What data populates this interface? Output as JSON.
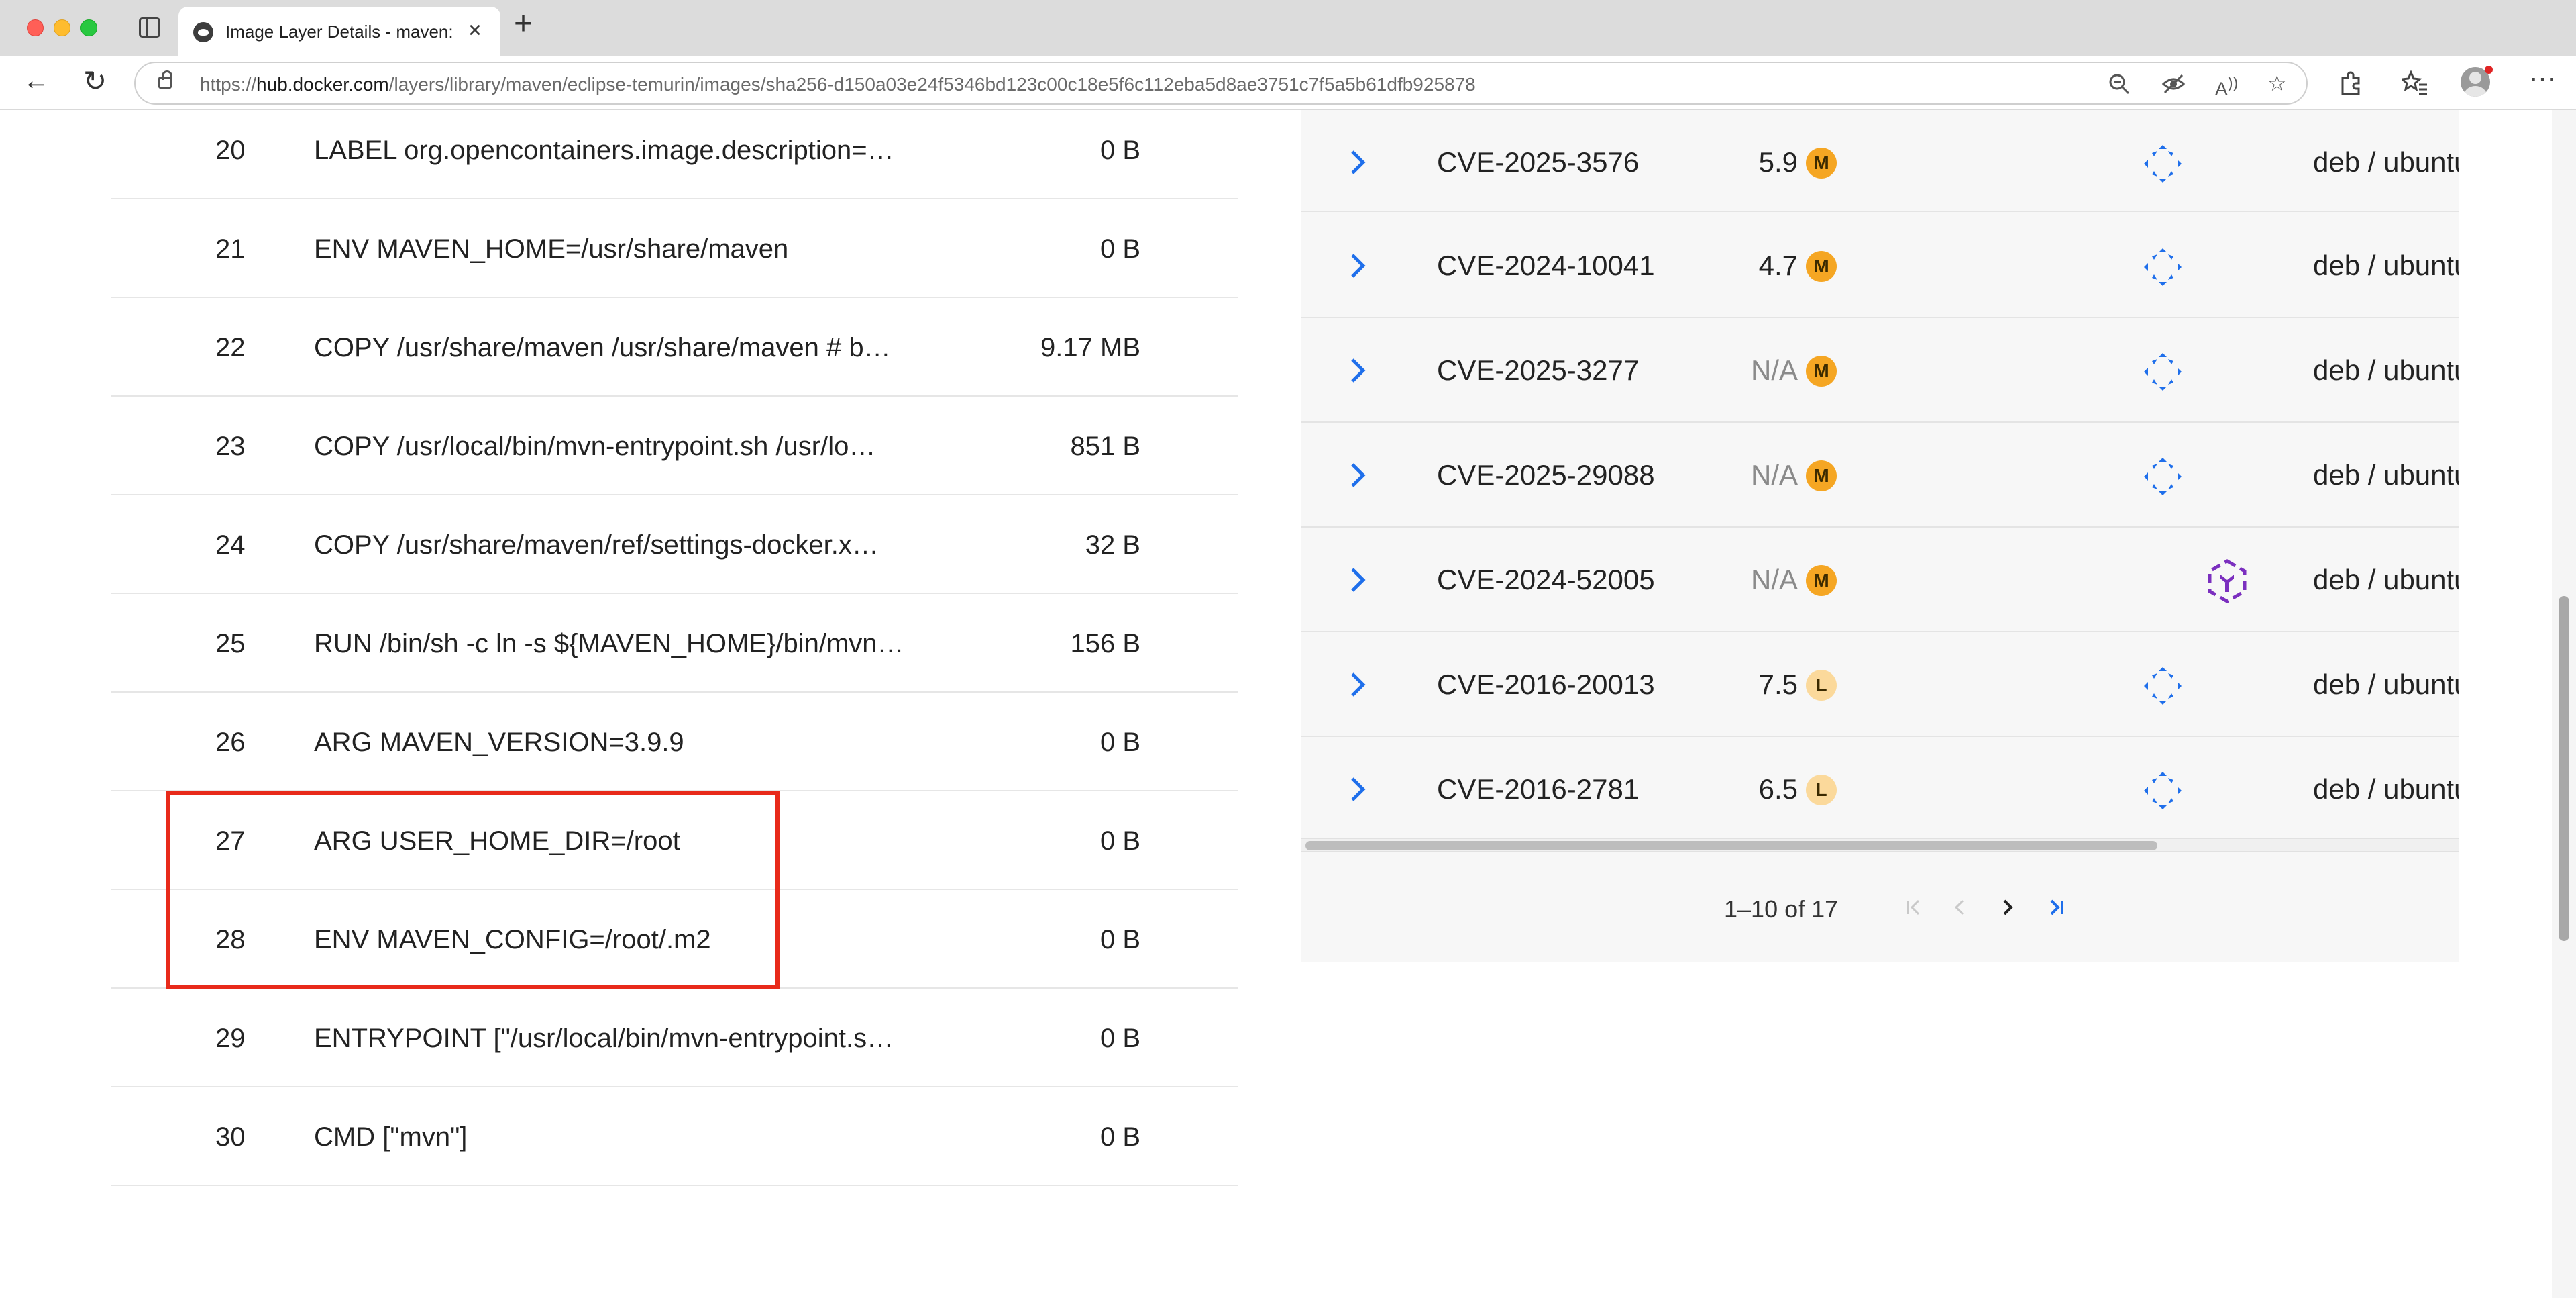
{
  "browser": {
    "tab_title": "Image Layer Details - maven:eclipse-temurin",
    "url_host_prefix": "https://",
    "url_host": "hub.docker.com",
    "url_path": "/layers/library/maven/eclipse-temurin/images/sha256-d150a03e24f5346bd123c00c18e5f6c112eba5d8ae3751c7f5a5b61dfb925878"
  },
  "layers": [
    {
      "num": "20",
      "command": "LABEL org.opencontainers.image.description=…",
      "size": "0 B"
    },
    {
      "num": "21",
      "command": "ENV MAVEN_HOME=/usr/share/maven",
      "size": "0 B"
    },
    {
      "num": "22",
      "command": "COPY /usr/share/maven /usr/share/maven # b…",
      "size": "9.17 MB"
    },
    {
      "num": "23",
      "command": "COPY /usr/local/bin/mvn-entrypoint.sh /usr/lo…",
      "size": "851 B"
    },
    {
      "num": "24",
      "command": "COPY /usr/share/maven/ref/settings-docker.x…",
      "size": "32 B"
    },
    {
      "num": "25",
      "command": "RUN /bin/sh -c ln -s ${MAVEN_HOME}/bin/mvn…",
      "size": "156 B"
    },
    {
      "num": "26",
      "command": "ARG MAVEN_VERSION=3.9.9",
      "size": "0 B"
    },
    {
      "num": "27",
      "command": "ARG USER_HOME_DIR=/root",
      "size": "0 B"
    },
    {
      "num": "28",
      "command": "ENV MAVEN_CONFIG=/root/.m2",
      "size": "0 B"
    },
    {
      "num": "29",
      "command": "ENTRYPOINT [\"/usr/local/bin/mvn-entrypoint.s…",
      "size": "0 B"
    },
    {
      "num": "30",
      "command": "CMD [\"mvn\"]",
      "size": "0 B"
    }
  ],
  "vulnerabilities": [
    {
      "cve": "CVE-2025-3576",
      "score": "5.9",
      "severity": "M",
      "source_icon": "blue",
      "package": "deb / ubuntu"
    },
    {
      "cve": "CVE-2024-10041",
      "score": "4.7",
      "severity": "M",
      "source_icon": "blue",
      "package": "deb / ubuntu"
    },
    {
      "cve": "CVE-2025-3277",
      "score": "N/A",
      "severity": "M",
      "source_icon": "blue",
      "package": "deb / ubuntu"
    },
    {
      "cve": "CVE-2025-29088",
      "score": "N/A",
      "severity": "M",
      "source_icon": "blue",
      "package": "deb / ubuntu"
    },
    {
      "cve": "CVE-2024-52005",
      "score": "N/A",
      "severity": "M",
      "source_icon": "purple",
      "package": "deb / ubuntu"
    },
    {
      "cve": "CVE-2016-20013",
      "score": "7.5",
      "severity": "L",
      "source_icon": "blue",
      "package": "deb / ubuntu"
    },
    {
      "cve": "CVE-2016-2781",
      "score": "6.5",
      "severity": "L",
      "source_icon": "blue",
      "package": "deb / ubuntu"
    }
  ],
  "pagination": {
    "label": "1–10 of 17"
  },
  "colors": {
    "highlight": "#e82a1a",
    "link_blue": "#1f6feb",
    "severity_medium": "#f5a623",
    "severity_low": "#fbd99b",
    "purple_icon": "#7b2fbf"
  }
}
